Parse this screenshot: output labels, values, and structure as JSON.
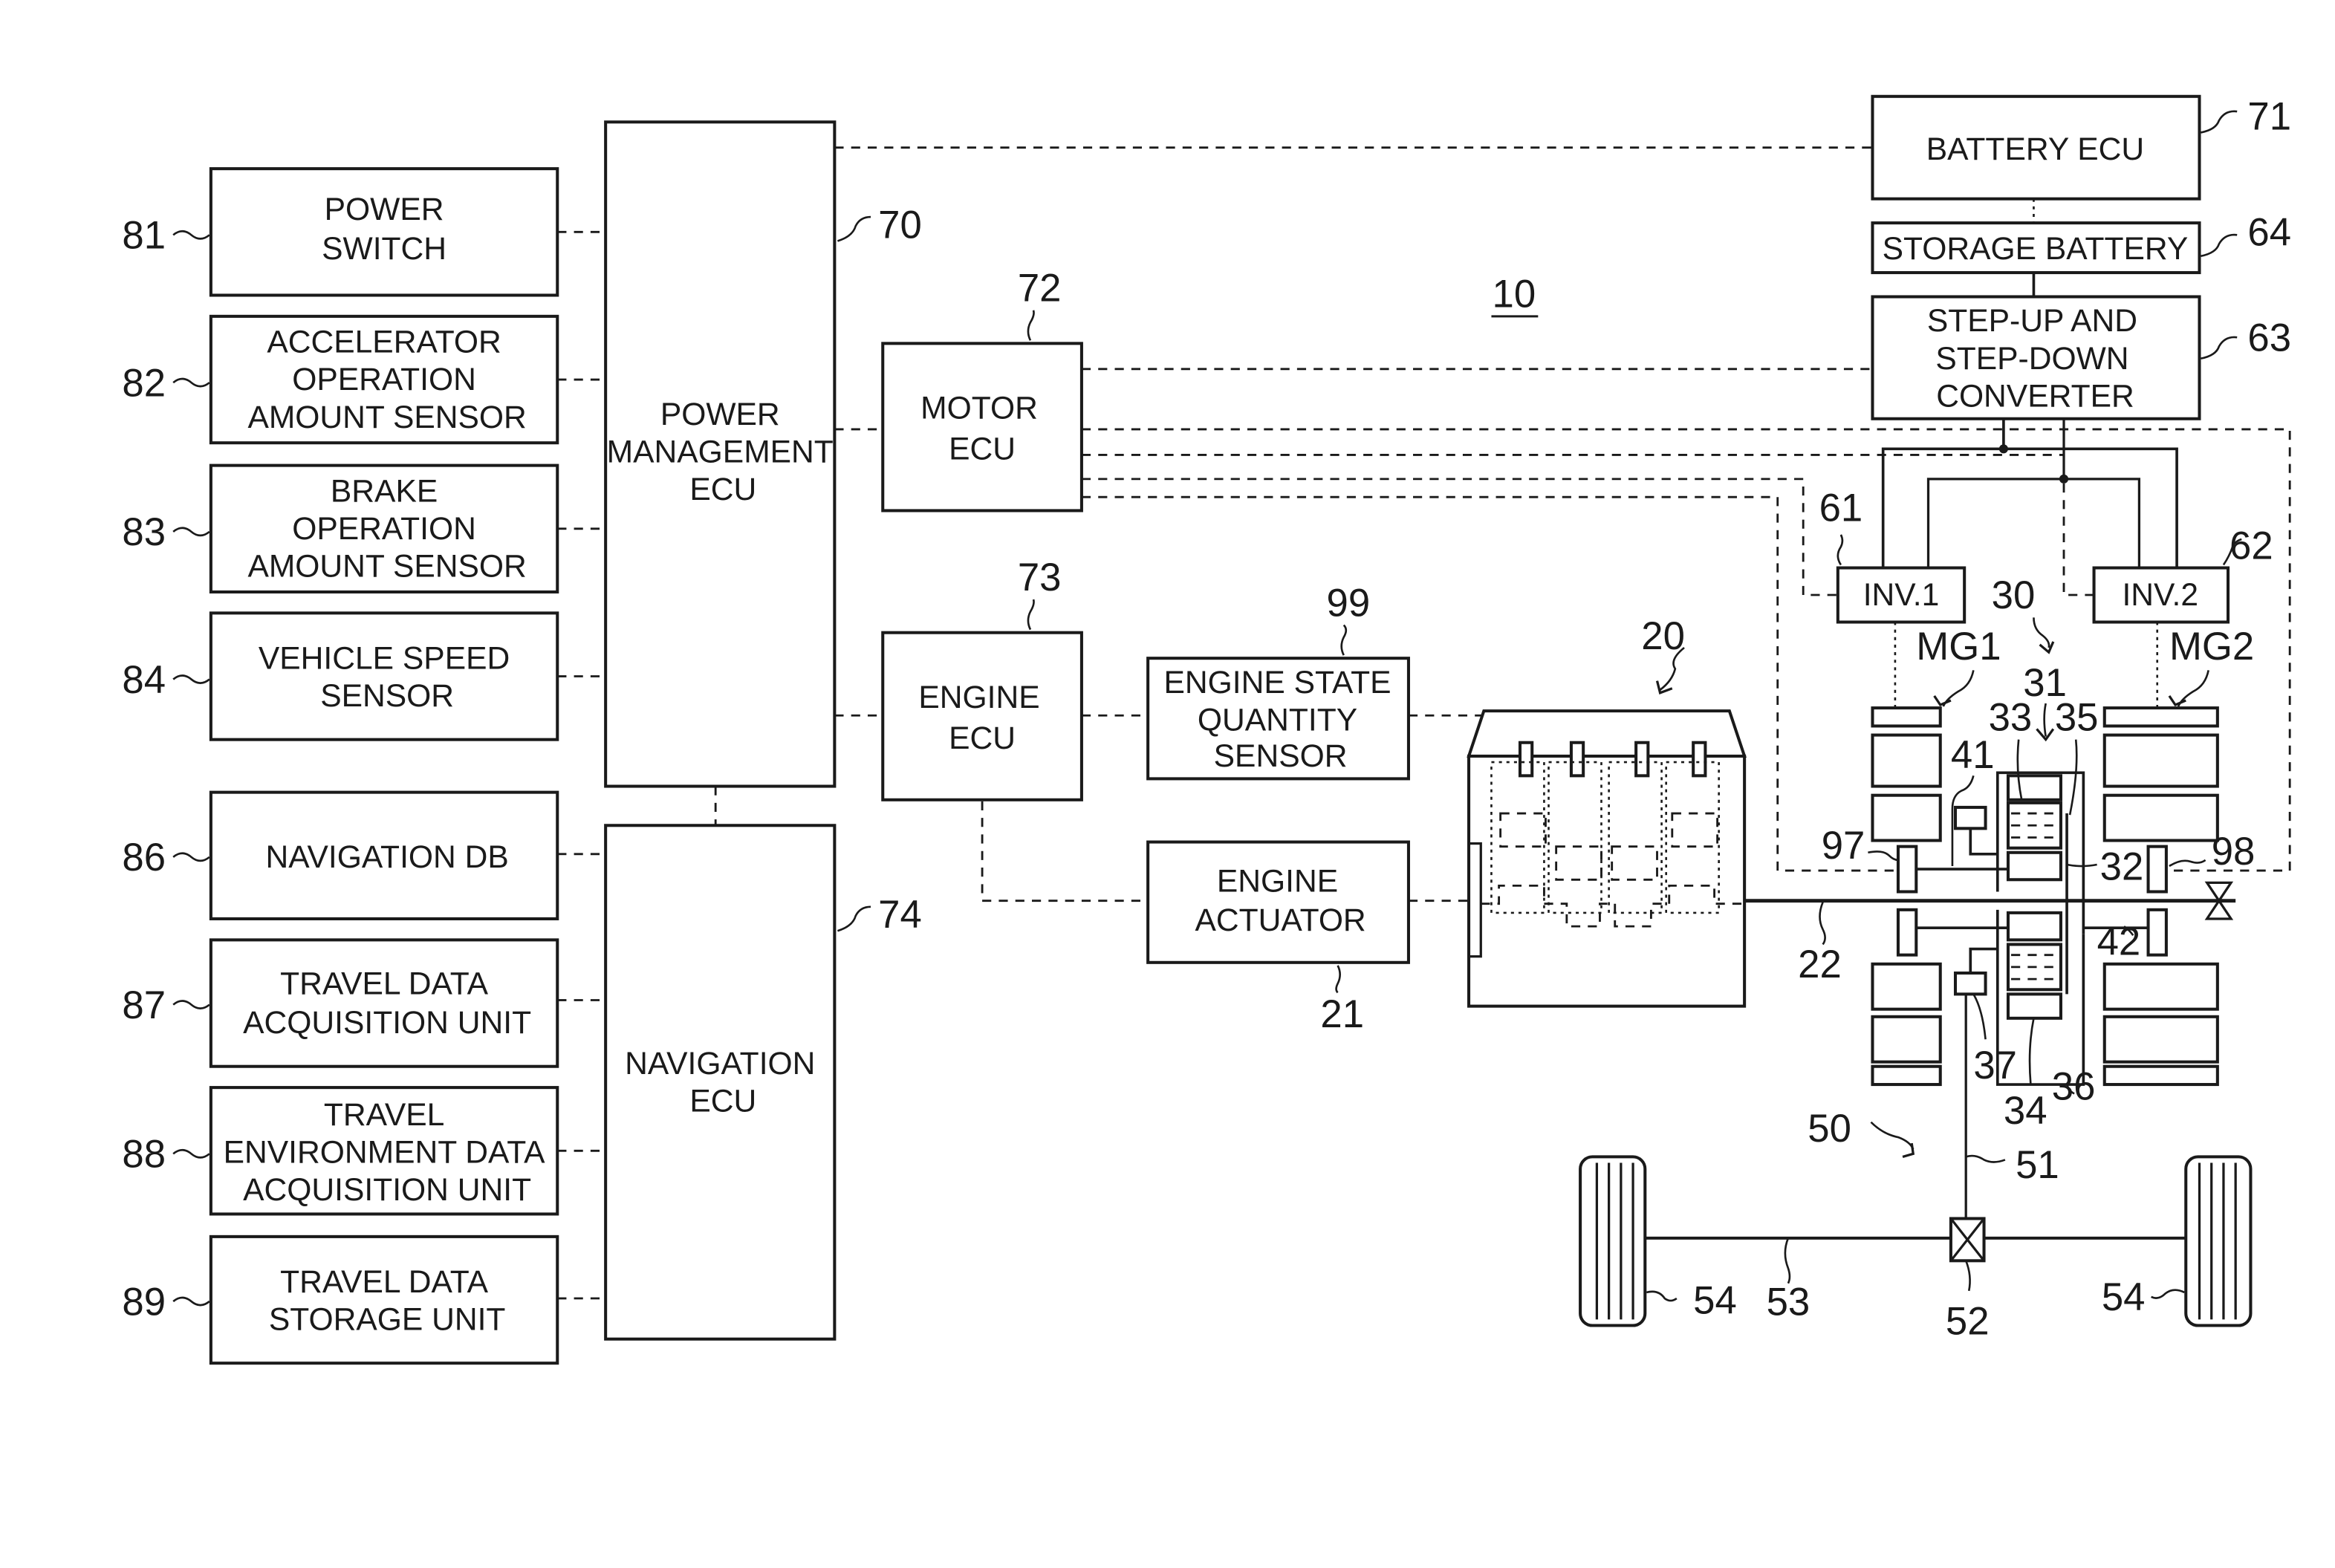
{
  "figure": {
    "system_ref": "10",
    "type": "hybrid vehicle control system block diagram"
  },
  "sensors": [
    {
      "ref": "81",
      "lines": [
        "POWER",
        "SWITCH"
      ]
    },
    {
      "ref": "82",
      "lines": [
        "ACCELERATOR",
        "OPERATION",
        "AMOUNT SENSOR"
      ]
    },
    {
      "ref": "83",
      "lines": [
        "BRAKE",
        "OPERATION",
        "AMOUNT SENSOR"
      ]
    },
    {
      "ref": "84",
      "lines": [
        "VEHICLE SPEED",
        "SENSOR"
      ]
    }
  ],
  "nav_units": [
    {
      "ref": "86",
      "lines": [
        "NAVIGATION DB"
      ]
    },
    {
      "ref": "87",
      "lines": [
        "TRAVEL DATA",
        "ACQUISITION UNIT"
      ]
    },
    {
      "ref": "88",
      "lines": [
        "TRAVEL",
        "ENVIRONMENT DATA",
        "ACQUISITION UNIT"
      ]
    },
    {
      "ref": "89",
      "lines": [
        "TRAVEL DATA",
        "STORAGE UNIT"
      ]
    }
  ],
  "ecus": {
    "power_management": {
      "ref": "70",
      "lines": [
        "POWER",
        "MANAGEMENT",
        "ECU"
      ]
    },
    "navigation": {
      "ref": "74",
      "lines": [
        "NAVIGATION",
        "ECU"
      ]
    },
    "motor": {
      "ref": "72",
      "lines": [
        "MOTOR",
        "ECU"
      ]
    },
    "engine": {
      "ref": "73",
      "lines": [
        "ENGINE",
        "ECU"
      ]
    },
    "battery": {
      "ref": "71",
      "lines": [
        "BATTERY ECU"
      ]
    }
  },
  "engine_blocks": {
    "state_sensor": {
      "ref": "99",
      "lines": [
        "ENGINE STATE",
        "QUANTITY",
        "SENSOR"
      ]
    },
    "actuator": {
      "ref": "21",
      "lines": [
        "ENGINE",
        "ACTUATOR"
      ]
    },
    "engine_ref": "20",
    "crankshaft_ref": "22"
  },
  "power_electronics": {
    "storage_battery": {
      "ref": "64",
      "lines": [
        "STORAGE BATTERY"
      ]
    },
    "converter": {
      "ref": "63",
      "lines": [
        "STEP-UP AND",
        "STEP-DOWN",
        "CONVERTER"
      ]
    },
    "inverter1": {
      "ref": "61",
      "label": "INV.1"
    },
    "inverter2": {
      "ref": "62",
      "label": "INV.2"
    }
  },
  "drivetrain": {
    "mg1": "MG1",
    "mg2": "MG2",
    "refs": {
      "transmission": "30",
      "planetary": "31",
      "sun": "32",
      "ring": "33",
      "pinion": "34",
      "carrier": "35",
      "output": "36",
      "gear37": "37",
      "shaft41": "41",
      "shaft42": "42",
      "sensor97": "97",
      "sensor98": "98",
      "drive_unit": "50",
      "drive_shaft": "51",
      "differential": "52",
      "axle": "53",
      "wheel": "54"
    }
  }
}
